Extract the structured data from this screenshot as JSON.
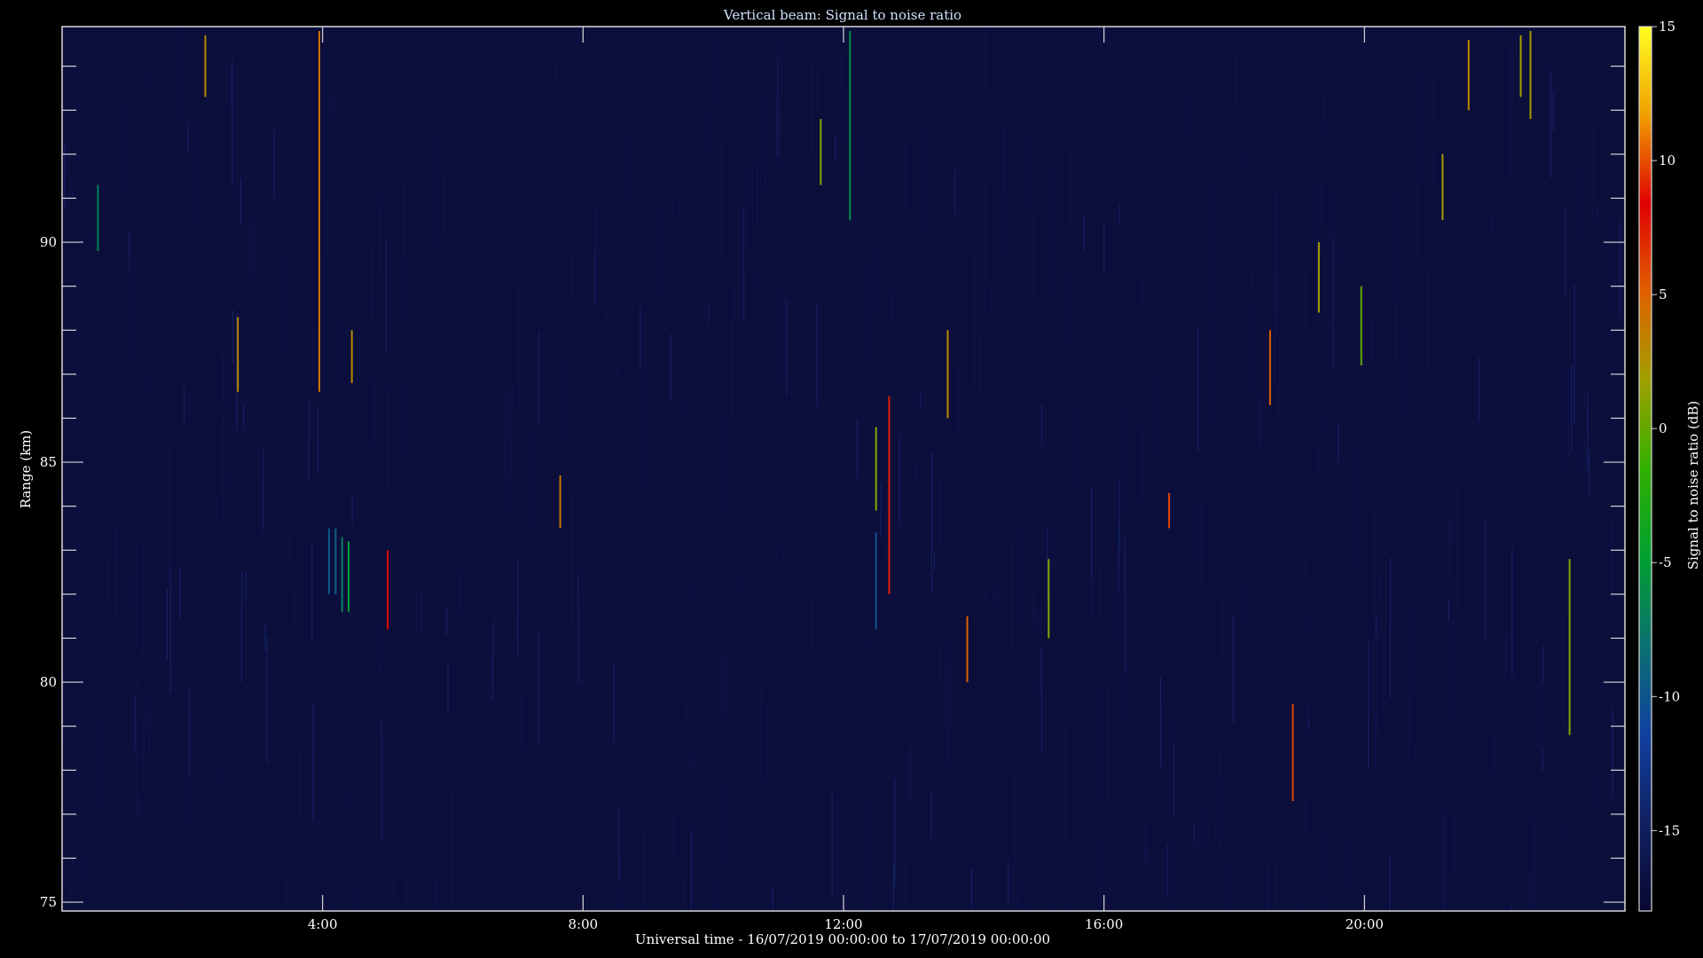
{
  "chart_data": {
    "type": "heatmap",
    "title": "Vertical beam: Signal to noise ratio",
    "xlabel": "Universal time - 16/07/2019 00:00:00 to 17/07/2019 00:00:00",
    "ylabel": "Range (km)",
    "xlim": [
      0,
      24
    ],
    "ylim": [
      74.8,
      94.9
    ],
    "x_ticks": [
      4,
      8,
      12,
      16,
      20
    ],
    "x_tick_labels": [
      "4:00",
      "8:00",
      "12:00",
      "16:00",
      "20:00"
    ],
    "y_ticks": [
      75,
      80,
      85,
      90
    ],
    "y_tick_labels": [
      "75",
      "80",
      "85",
      "90"
    ],
    "colorbar": {
      "label": "Signal to noise ratio (dB)",
      "range": [
        -18,
        15
      ],
      "ticks": [
        15,
        10,
        5,
        0,
        -5,
        -10,
        -15
      ],
      "tick_labels": [
        "15",
        "10",
        "5",
        "0",
        "-5",
        "-10",
        "-15"
      ],
      "colormap": [
        "#080830",
        "#102060",
        "#1040a0",
        "#0a7070",
        "#00a030",
        "#30b000",
        "#a0a000",
        "#e06000",
        "#e00000",
        "#f0a000",
        "#ffff20"
      ]
    },
    "background_color": "#0c0e3c",
    "frame_color": "#d8d8d8",
    "features": [
      {
        "t": 2.2,
        "r0": 93.3,
        "r1": 94.7,
        "snr": 3
      },
      {
        "t": 2.7,
        "r0": 86.6,
        "r1": 88.3,
        "snr": 3
      },
      {
        "t": 3.95,
        "r0": 86.6,
        "r1": 94.8,
        "snr": 4
      },
      {
        "t": 4.45,
        "r0": 86.8,
        "r1": 88.0,
        "snr": 3
      },
      {
        "t": 0.55,
        "r0": 89.8,
        "r1": 91.3,
        "snr": -7
      },
      {
        "t": 5.0,
        "r0": 81.2,
        "r1": 83.0,
        "snr": 8
      },
      {
        "t": 7.65,
        "r0": 83.5,
        "r1": 84.7,
        "snr": 4
      },
      {
        "t": 11.65,
        "r0": 91.3,
        "r1": 92.8,
        "snr": 1
      },
      {
        "t": 12.1,
        "r0": 90.5,
        "r1": 94.8,
        "snr": -6
      },
      {
        "t": 12.5,
        "r0": 83.9,
        "r1": 85.8,
        "snr": 1
      },
      {
        "t": 12.7,
        "r0": 82.0,
        "r1": 86.5,
        "snr": 9
      },
      {
        "t": 13.6,
        "r0": 86.0,
        "r1": 88.0,
        "snr": 3
      },
      {
        "t": 13.9,
        "r0": 80.0,
        "r1": 81.5,
        "snr": 5
      },
      {
        "t": 15.15,
        "r0": 81.0,
        "r1": 82.8,
        "snr": 1
      },
      {
        "t": 17.0,
        "r0": 83.5,
        "r1": 84.3,
        "snr": 6
      },
      {
        "t": 18.55,
        "r0": 86.3,
        "r1": 88.0,
        "snr": 5
      },
      {
        "t": 18.9,
        "r0": 77.3,
        "r1": 79.5,
        "snr": 6
      },
      {
        "t": 19.3,
        "r0": 88.4,
        "r1": 90.0,
        "snr": 2
      },
      {
        "t": 19.95,
        "r0": 87.2,
        "r1": 89.0,
        "snr": 0
      },
      {
        "t": 21.2,
        "r0": 90.5,
        "r1": 92.0,
        "snr": 2
      },
      {
        "t": 21.6,
        "r0": 93.0,
        "r1": 94.6,
        "snr": 3
      },
      {
        "t": 22.4,
        "r0": 93.3,
        "r1": 94.7,
        "snr": 2
      },
      {
        "t": 22.55,
        "r0": 92.8,
        "r1": 94.8,
        "snr": 2
      },
      {
        "t": 23.15,
        "r0": 78.8,
        "r1": 82.8,
        "snr": 1
      },
      {
        "t": 4.1,
        "r0": 82.0,
        "r1": 83.5,
        "snr": -10
      },
      {
        "t": 4.2,
        "r0": 82.0,
        "r1": 83.5,
        "snr": -9
      },
      {
        "t": 4.3,
        "r0": 81.6,
        "r1": 83.3,
        "snr": -7
      },
      {
        "t": 4.4,
        "r0": 81.6,
        "r1": 83.2,
        "snr": -5
      },
      {
        "t": 12.5,
        "r0": 81.2,
        "r1": 83.4,
        "snr": -10
      }
    ]
  }
}
